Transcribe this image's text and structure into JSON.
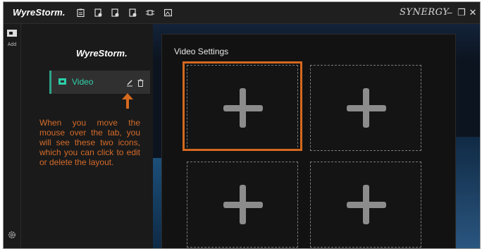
{
  "titlebar": {
    "logo": "WyreStorm.",
    "toolbar_icons": [
      "clipboard-icon",
      "save-file-icon",
      "import-file-icon",
      "export-file-icon",
      "network-icon",
      "image-icon"
    ],
    "brand": "SYNERGY",
    "window_controls": {
      "minimize": "–",
      "restore": "❐",
      "close": "✕"
    }
  },
  "sidebar": {
    "add_label": "Add",
    "settings_icon": "gear-icon"
  },
  "layout_panel": {
    "brand": "WyreStorm.",
    "tab_label": "Video",
    "tab_icon": "monitor-icon",
    "edit_icon": "pencil-icon",
    "delete_icon": "trash-icon"
  },
  "annotation": {
    "text": "When you move the mouse over the tab, you will see these two icons, which you can click to edit or delete the layout.",
    "color": "#d46b2a"
  },
  "video_settings": {
    "title": "Video Settings",
    "cells": [
      "add-source",
      "add-source",
      "add-source",
      "add-source"
    ]
  },
  "colors": {
    "accent": "#2fd3a9",
    "annotation": "#d4691f",
    "background": "#141414"
  }
}
